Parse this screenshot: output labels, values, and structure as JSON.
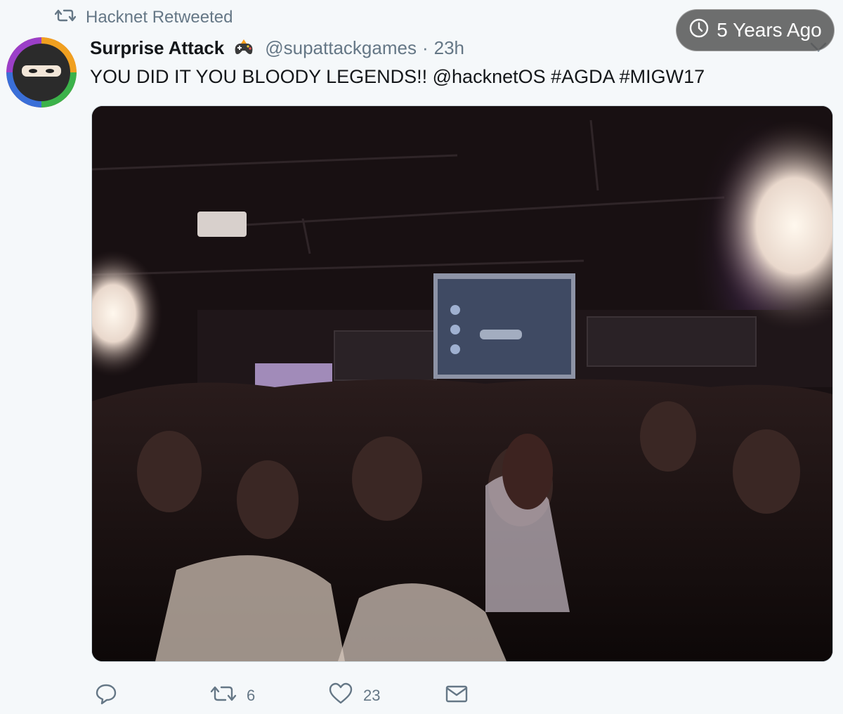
{
  "retweet_context": {
    "icon": "retweet-icon",
    "label": "Hacknet Retweeted"
  },
  "author": {
    "display_name": "Surprise Attack",
    "badge_icon": "game-controller-emoji-icon",
    "handle": "@supattackgames",
    "separator": "·",
    "timestamp": "23h",
    "avatar_icon": "ninja-avatar-icon"
  },
  "tweet": {
    "text": "YOU DID IT YOU BLOODY LEGENDS!! @hacknetOS #AGDA #MIGW17"
  },
  "overlay": {
    "icon": "clock-icon",
    "label": "5 Years Ago"
  },
  "media": {
    "icon": "event-crowd-photo"
  },
  "actions": {
    "reply": {
      "icon": "reply-icon",
      "count": ""
    },
    "retweet": {
      "icon": "retweet-icon",
      "count": "6"
    },
    "like": {
      "icon": "heart-icon",
      "count": "23"
    },
    "message": {
      "icon": "envelope-icon",
      "count": ""
    }
  },
  "colors": {
    "background": "#f5f8fa",
    "secondary_text": "#657786",
    "primary_text": "#14171a",
    "overlay_pill": "#5a5a5a"
  }
}
